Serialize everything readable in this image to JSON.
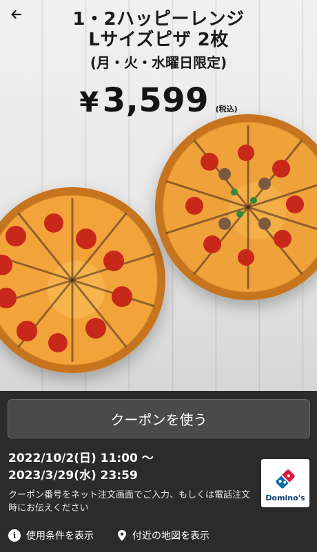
{
  "header": {
    "back_label": "←"
  },
  "promo": {
    "title_line1": "1・2ハッピーレンジ",
    "title_line2": "Lサイズピザ 2枚",
    "title_line3": "(月・火・水曜日限定)",
    "price_symbol": "¥",
    "price_value": "3,599",
    "tax_label": "(税込)"
  },
  "actions": {
    "use_coupon_label": "クーポンを使う"
  },
  "validity": {
    "line1": "2022/10/2(日) 11:00 〜",
    "line2": "2023/3/29(水) 23:59"
  },
  "note": {
    "text": "クーポン番号をネット注文画面でご入力、もしくは電話注文時にお伝えください"
  },
  "brand": {
    "name": "Domino's",
    "colors": {
      "blue": "#0b6aa8",
      "red": "#e31837"
    }
  },
  "footer": {
    "terms_icon": "info-icon",
    "terms_label": "使用条件を表示",
    "map_icon": "location-pin-icon",
    "map_label": "付近の地図を表示"
  }
}
